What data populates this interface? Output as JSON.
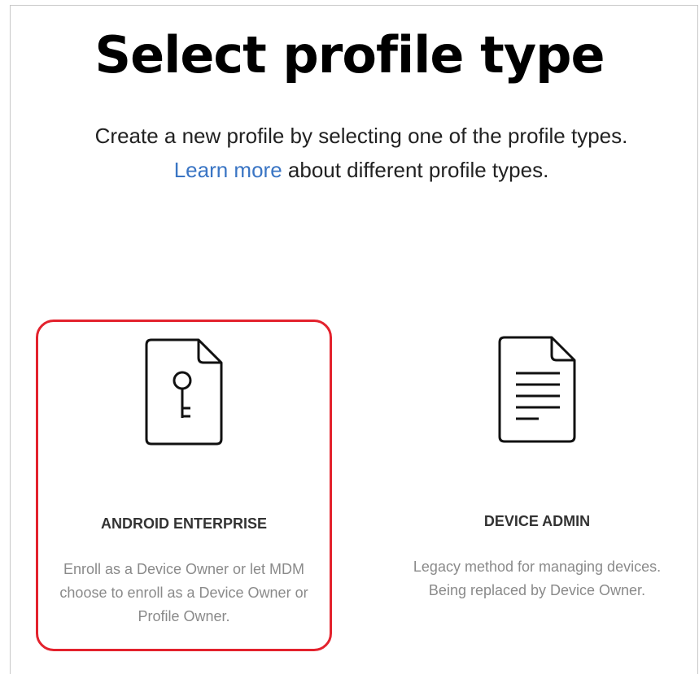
{
  "header": {
    "title": "Select profile type",
    "subtitle_line1": "Create a new profile by selecting one of the profile types.",
    "learn_more_link": "Learn more",
    "subtitle_line2_rest": " about different profile types."
  },
  "cards": [
    {
      "title": "ANDROID ENTERPRISE",
      "description": "Enroll as a Device Owner or let MDM choose to enroll as a Device Owner or Profile Owner.",
      "icon": "document-key-icon",
      "selected": true
    },
    {
      "title": "DEVICE ADMIN",
      "description": "Legacy method for managing devices. Being replaced by Device Owner.",
      "icon": "document-lines-icon",
      "selected": false
    }
  ],
  "colors": {
    "selection_border": "#e3222d",
    "link": "#3a75c4"
  }
}
